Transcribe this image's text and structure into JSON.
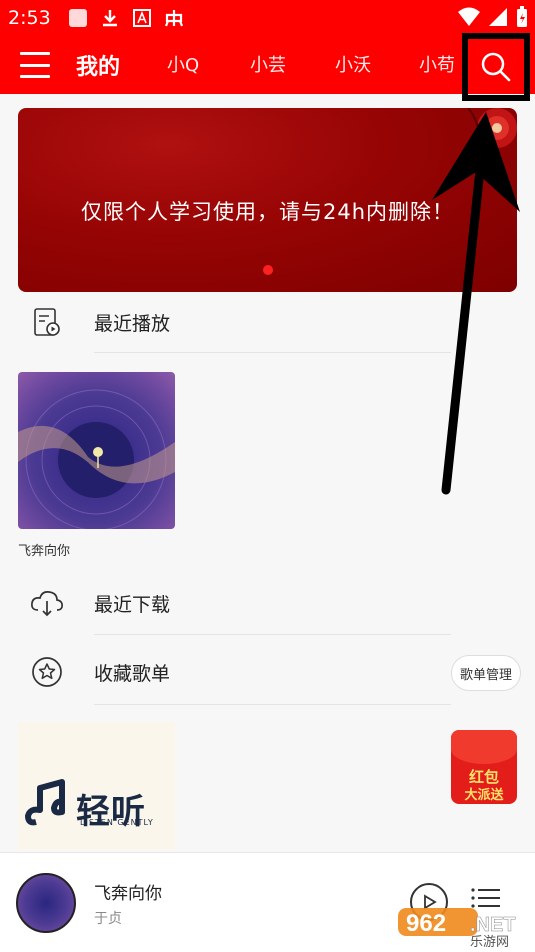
{
  "status_bar": {
    "time": "2:53"
  },
  "nav": {
    "tabs": [
      {
        "label": "我的",
        "active": true
      },
      {
        "label": "小Q",
        "active": false
      },
      {
        "label": "小芸",
        "active": false
      },
      {
        "label": "小沃",
        "active": false
      },
      {
        "label": "小苟",
        "active": false
      }
    ],
    "menu_icon": "hamburger-icon",
    "search_icon": "search-icon",
    "accent_color": "#ff0000"
  },
  "banner": {
    "text": "仅限个人学习使用，请与24h内删除！"
  },
  "recent_play": {
    "label": "最近播放",
    "icon": "recent-play-icon"
  },
  "recent_album": {
    "caption": "飞奔向你"
  },
  "recent_download": {
    "label": "最近下载",
    "icon": "cloud-download-icon"
  },
  "favorites": {
    "label": "收藏歌单",
    "icon": "star-icon",
    "manage_label": "歌单管理"
  },
  "playlist_card": {
    "title": "轻听",
    "subtitle": "LISTEN GENTLY"
  },
  "red_packet": {
    "line1": "红包",
    "line2": "大派送"
  },
  "player": {
    "title": "飞奔向你",
    "artist": "于贞",
    "play_icon": "play-icon",
    "list_icon": "playlist-icon"
  },
  "watermark": {
    "text1": "962",
    "text2": ".NET",
    "text3": "乐游网"
  }
}
